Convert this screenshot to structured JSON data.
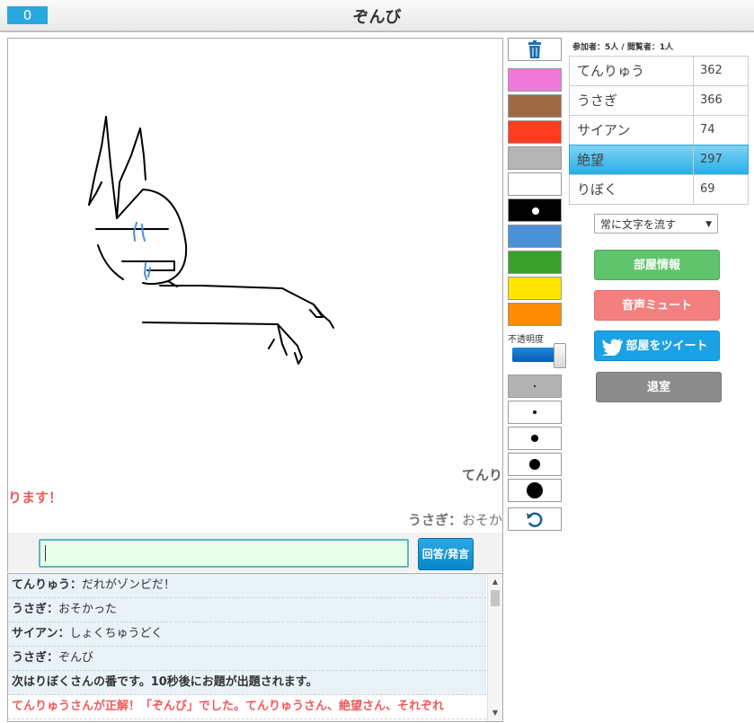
{
  "header": {
    "counter": "0",
    "title": "ぞんび"
  },
  "canvas": {
    "floating_messages": [
      {
        "text": "てんり"
      },
      {
        "text": "ります！"
      },
      {
        "name": "うさぎ：",
        "text": "おそか"
      }
    ]
  },
  "chat_input": {
    "value": "",
    "send_label": "回答/発言"
  },
  "chat_log": [
    {
      "name": "てんりゅう：",
      "text": "だれがゾンビだ！"
    },
    {
      "name": "うさぎ：",
      "text": "おそかった"
    },
    {
      "name": "サイアン：",
      "text": "しょくちゅうどく"
    },
    {
      "name": "うさぎ：",
      "text": "ぞんび"
    },
    {
      "system": "次はりぼくさんの番です。10秒後にお題が出題されます。"
    },
    {
      "correct": "てんりゅうさんが正解！「ぞんび」でした。てんりゅうさん、絶望さん、それぞれ"
    }
  ],
  "tools": {
    "colors": [
      "#f07ad8",
      "#9e6a45",
      "#ff3c1e",
      "#b4b4b4",
      "#ffffff",
      "#000000",
      "#4a90d9",
      "#3aa02a",
      "#ffe600",
      "#ff8c00"
    ],
    "selected_color": "#000000",
    "opacity_label": "不透明度",
    "opacity_value": 1.0,
    "brush_sizes": [
      2,
      4,
      8,
      12,
      18
    ],
    "selected_size_index": 0
  },
  "room": {
    "participants": "参加者：5人 / 閲覧者：1人",
    "players": [
      {
        "name": "てんりゅう",
        "score": "362"
      },
      {
        "name": "うさぎ",
        "score": "366"
      },
      {
        "name": "サイアン",
        "score": "74"
      },
      {
        "name": "絶望",
        "score": "297"
      },
      {
        "name": "りぼく",
        "score": "69"
      }
    ],
    "active_player_index": 3,
    "text_mode": "常に文字を流す",
    "buttons": {
      "room_info": "部屋情報",
      "mute": "音声ミュート",
      "tweet": "部屋をツイート",
      "exit": "退室"
    }
  },
  "accent_colors": {
    "primary": "#29a8e0",
    "green": "#5fc46b",
    "red": "#f47f7f",
    "gray": "#8c8c8c"
  }
}
